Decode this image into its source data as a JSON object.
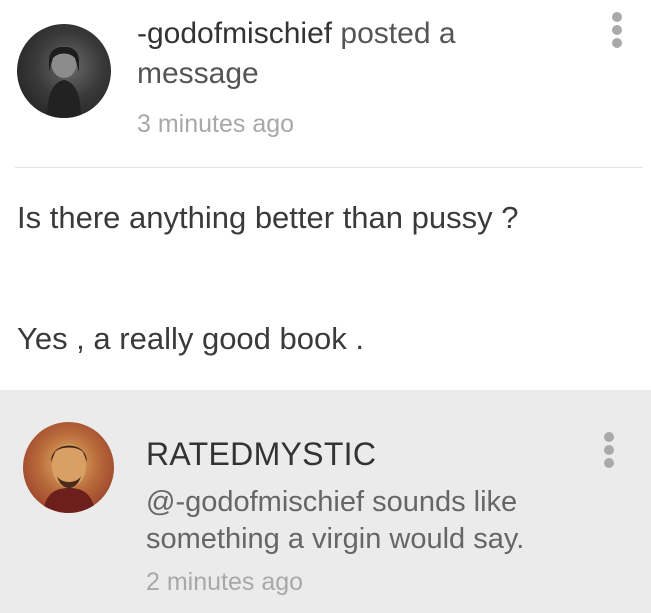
{
  "post": {
    "author": "-godofmischief",
    "action": " posted a message",
    "timestamp": "3 minutes ago",
    "menu_icon": "more-vertical-icon",
    "body": [
      "Is there anything better than pussy ?",
      "Yes , a really good book ."
    ]
  },
  "comment": {
    "author": "RATEDMYSTIC",
    "text": "@-godofmischief sounds like something a virgin would say.",
    "timestamp": "2 minutes ago",
    "menu_icon": "more-vertical-icon"
  },
  "colors": {
    "comment_background": "#ebebeb",
    "timestamp": "#a8a8a8",
    "divider": "#e3e3e3"
  }
}
